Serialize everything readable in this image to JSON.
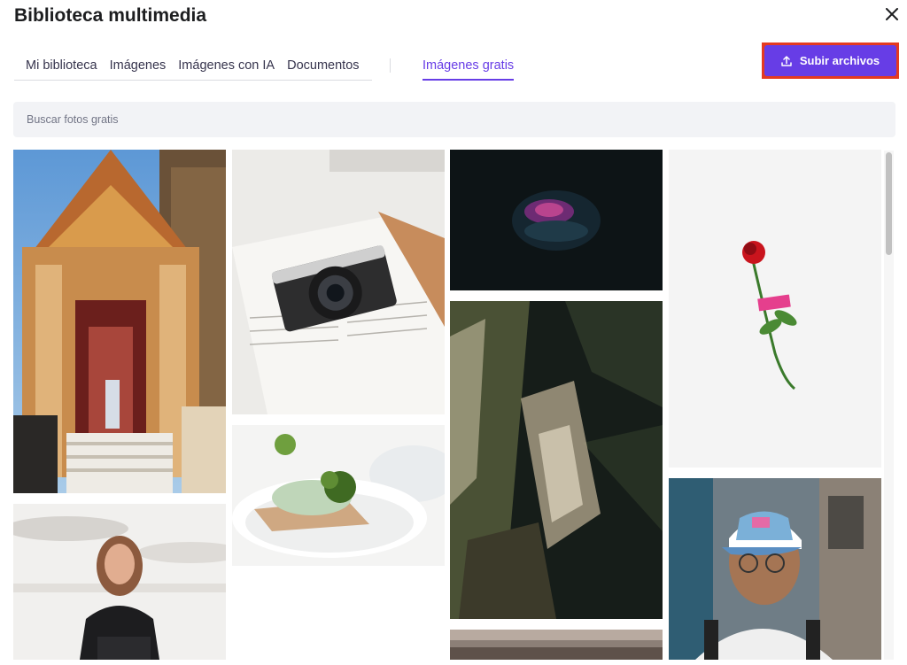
{
  "modal": {
    "title": "Biblioteca multimedia"
  },
  "tabs": [
    {
      "label": "Mi biblioteca"
    },
    {
      "label": "Imágenes"
    },
    {
      "label": "Imágenes con IA"
    },
    {
      "label": "Documentos"
    }
  ],
  "active_tab": {
    "label": "Imágenes gratis"
  },
  "upload_button": {
    "label": "Subir archivos"
  },
  "search": {
    "placeholder": "Buscar fotos gratis",
    "value": ""
  },
  "colors": {
    "accent": "#673de6",
    "highlight_border": "#e53a20",
    "search_bg": "#f2f3f6"
  },
  "icons": {
    "close": "close-icon",
    "upload": "upload-icon"
  }
}
